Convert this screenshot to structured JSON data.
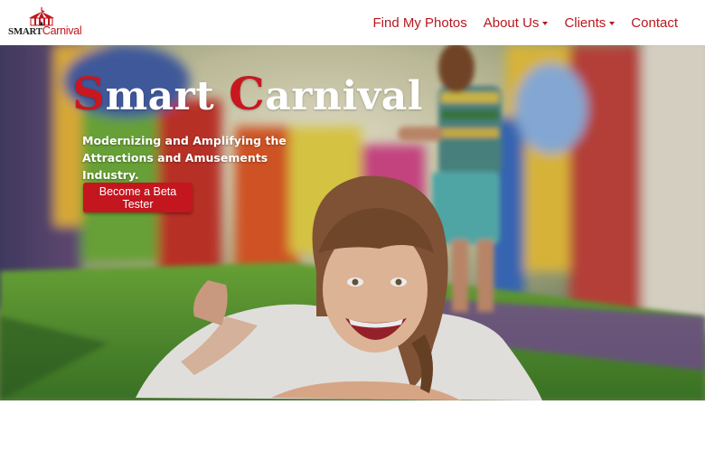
{
  "logo": {
    "smart": "SMART",
    "carnival": "Carnival"
  },
  "nav": [
    {
      "label": "Find My Photos",
      "dropdown": false
    },
    {
      "label": "About Us",
      "dropdown": true
    },
    {
      "label": "Clients",
      "dropdown": true
    },
    {
      "label": "Contact",
      "dropdown": false
    }
  ],
  "hero": {
    "title_initial_1": "S",
    "title_rest_1": "mart ",
    "title_initial_2": "C",
    "title_rest_2": "arnival",
    "subtitle": "Modernizing and Amplifying the Attractions and Amusements Industry.",
    "cta_label": "Become a Beta Tester"
  },
  "colors": {
    "brand_red": "#c4161f",
    "nav_red": "#b8181f",
    "white": "#ffffff"
  },
  "icons": {
    "logo": "circus-tent-icon",
    "dropdown": "caret-down-icon"
  }
}
